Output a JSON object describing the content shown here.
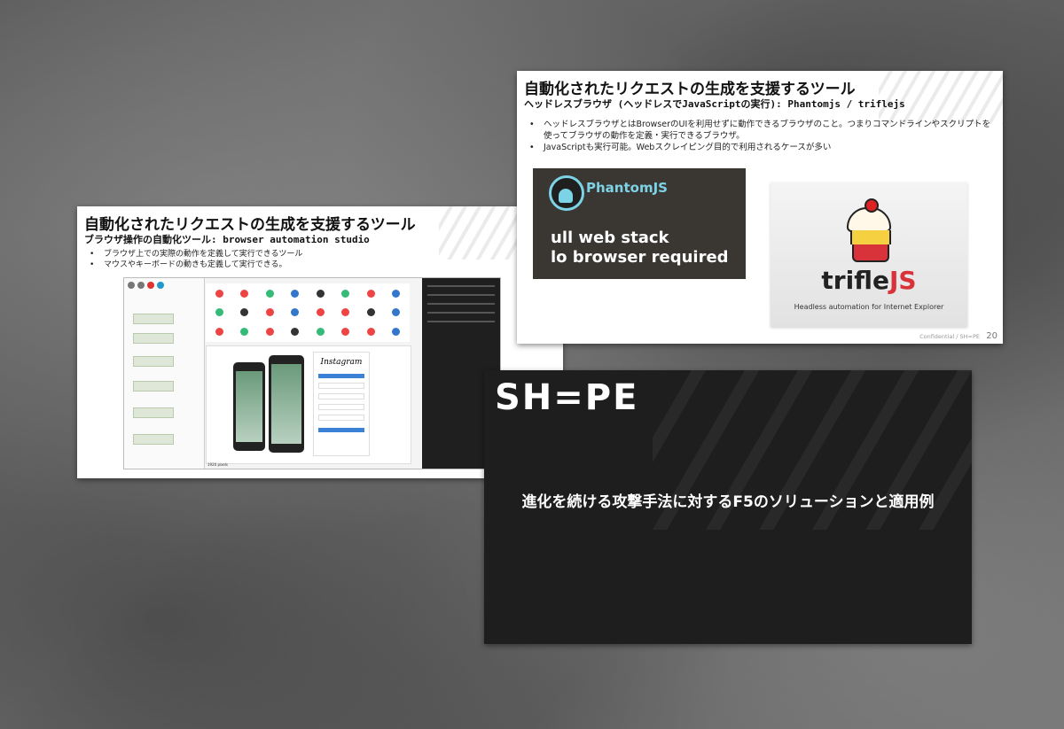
{
  "slide1": {
    "title": "自動化されたリクエストの生成を支援するツール",
    "subtitle": "ブラウザ操作の自動化ツール: browser automation studio",
    "bullets": [
      "ブラウザ上での実際の動作を定義して実行できるツール",
      "マウスやキーボードの動きも定義して実行できる。"
    ],
    "screenshot": {
      "instagram_logo": "Instagram",
      "status_text": "1920 pixels"
    }
  },
  "slide2": {
    "title": "自動化されたリクエストの生成を支援するツール",
    "subtitle": "ヘッドレスブラウザ (ヘッドレスでJavaScriptの実行): Phantomjs / triflejs",
    "bullets": [
      "ヘッドレスブラウザとはBrowserのUIを利用せずに動作できるブラウザのこと。つまりコマンドラインやスクリプトを使ってブラウザの動作を定義・実行できるブラウザ。",
      "JavaScriptも実行可能。Webスクレイピング目的で利用されるケースが多い"
    ],
    "phantom": {
      "name": "PhantomJS",
      "line1": "ull web stack",
      "line2": "lo browser required"
    },
    "trifle": {
      "word_main": "trifle",
      "word_js": "JS",
      "tagline": "Headless automation for Internet Explorer"
    },
    "footer": "Confidential / SH=PE",
    "page_number": "20"
  },
  "slide3": {
    "logo": "SH=PE",
    "title": "進化を続ける攻撃手法に対するF5のソリューションと適用例"
  }
}
